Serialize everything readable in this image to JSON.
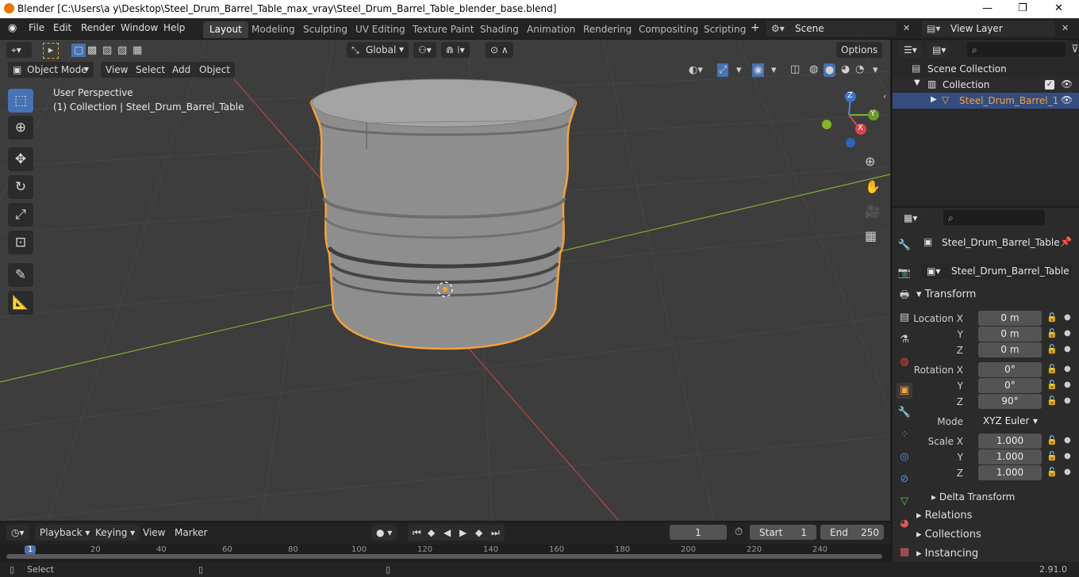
{
  "window": {
    "title": "Blender [C:\\Users\\a y\\Desktop\\Steel_Drum_Barrel_Table_max_vray\\Steel_Drum_Barrel_Table_blender_base.blend]",
    "minimize": "—",
    "maximize": "❐",
    "close": "✕"
  },
  "menus": [
    "File",
    "Edit",
    "Render",
    "Window",
    "Help"
  ],
  "workspaces": [
    "Layout",
    "Modeling",
    "Sculpting",
    "UV Editing",
    "Texture Paint",
    "Shading",
    "Animation",
    "Rendering",
    "Compositing",
    "Scripting"
  ],
  "active_workspace": "Layout",
  "add_workspace": "+",
  "scene": {
    "label": "Scene"
  },
  "view_layer": {
    "label": "View Layer"
  },
  "viewport_header": {
    "mode": "Object Mode",
    "menus": [
      "View",
      "Select",
      "Add",
      "Object"
    ],
    "orientation": "Global",
    "options": "Options"
  },
  "viewport": {
    "perspective": "User Perspective",
    "collection_info": "(1) Collection | Steel_Drum_Barrel_Table",
    "gizmo": {
      "x": "X",
      "y": "Y",
      "z": "Z"
    }
  },
  "outliner": {
    "scene_collection": "Scene Collection",
    "collection": "Collection",
    "object": "Steel_Drum_Barrel_1"
  },
  "properties": {
    "object_name": "Steel_Drum_Barrel_Table",
    "data_name": "Steel_Drum_Barrel_Table",
    "transform_label": "Transform",
    "location": {
      "label": "Location X",
      "y_label": "Y",
      "z_label": "Z",
      "x": "0 m",
      "y": "0 m",
      "z": "0 m"
    },
    "rotation": {
      "label": "Rotation X",
      "y_label": "Y",
      "z_label": "Z",
      "x": "0°",
      "y": "0°",
      "z": "90°"
    },
    "mode": {
      "label": "Mode",
      "value": "XYZ Euler"
    },
    "scale": {
      "label": "Scale X",
      "y_label": "Y",
      "z_label": "Z",
      "x": "1.000",
      "y": "1.000",
      "z": "1.000"
    },
    "delta_transform": "Delta Transform",
    "sections": [
      "Relations",
      "Collections",
      "Instancing"
    ]
  },
  "timeline": {
    "menus": [
      "Playback",
      "Keying",
      "View",
      "Marker"
    ],
    "current_frame": "1",
    "start_label": "Start",
    "start": "1",
    "end_label": "End",
    "end": "250",
    "ruler": [
      "1",
      "20",
      "40",
      "60",
      "80",
      "100",
      "120",
      "140",
      "160",
      "180",
      "200",
      "220",
      "240"
    ]
  },
  "status": {
    "left": "Select",
    "version": "2.91.0"
  },
  "colors": {
    "accent": "#4772b3",
    "selection_outline": "#f5a13a",
    "viewport_bg": "#3d3d3d",
    "axis_x": "#b84545",
    "axis_y": "#7fae33"
  }
}
